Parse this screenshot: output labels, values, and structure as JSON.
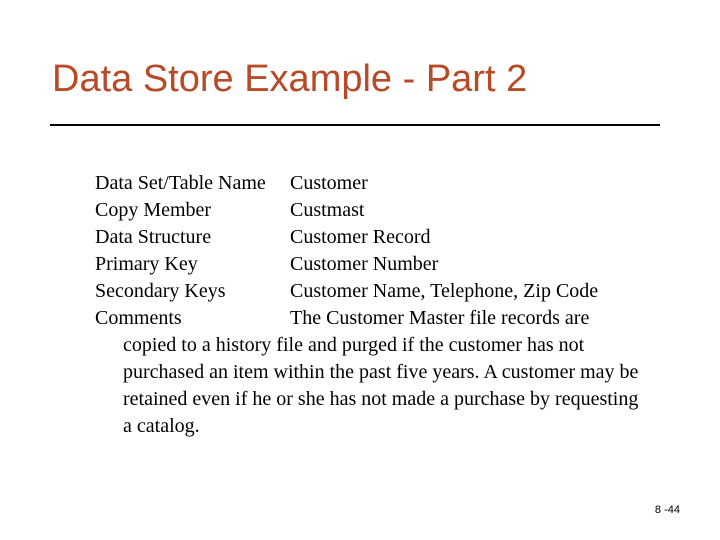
{
  "title": "Data Store Example - Part 2",
  "rows": [
    {
      "label": "Data Set/Table Name",
      "value": "Customer"
    },
    {
      "label": "Copy Member",
      "value": "Custmast"
    },
    {
      "label": "Data Structure",
      "value": "Customer Record"
    },
    {
      "label": "Primary Key",
      "value": "Customer Number"
    },
    {
      "label": "Secondary Keys",
      "value": "Customer Name, Telephone, Zip Code"
    },
    {
      "label": "Comments",
      "value": "The Customer Master file records are"
    }
  ],
  "continuation": "copied to a history file and purged if the customer has not purchased an item within the past five years.  A customer may be retained even if he or she has not made a purchase by requesting a catalog.",
  "page_number": "8 -44"
}
